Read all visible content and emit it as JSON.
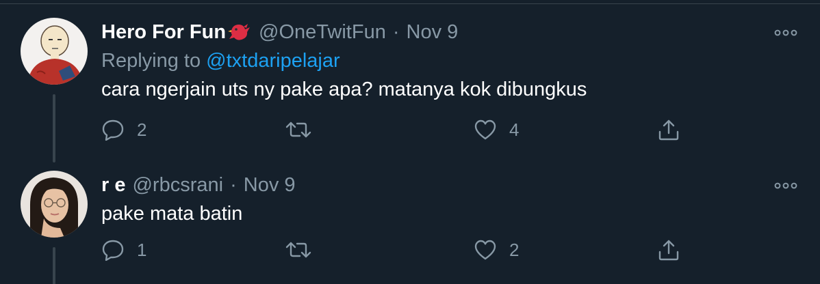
{
  "tweets": [
    {
      "name": "Hero For Fun",
      "handle": "@OneTwitFun",
      "separator": "·",
      "date": "Nov 9",
      "replying_prefix": "Replying to",
      "replying_to": "@txtdaripelajar",
      "text": "cara ngerjain uts ny pake apa? matanya kok dibungkus",
      "reply_count": "2",
      "retweet_count": "",
      "like_count": "4",
      "avatar_icon": "cartoon-avatar-icon",
      "name_emoji": "red-bird-icon"
    },
    {
      "name": "r e",
      "handle": "@rbcsrani",
      "separator": "·",
      "date": "Nov 9",
      "text": "pake mata batin",
      "reply_count": "1",
      "retweet_count": "",
      "like_count": "2",
      "avatar_icon": "photo-avatar-icon"
    }
  ],
  "colors": {
    "background": "#15202b",
    "primary_text": "#ffffff",
    "secondary_text": "#8899a6",
    "accent": "#1da1f2",
    "divider": "#38444d"
  }
}
